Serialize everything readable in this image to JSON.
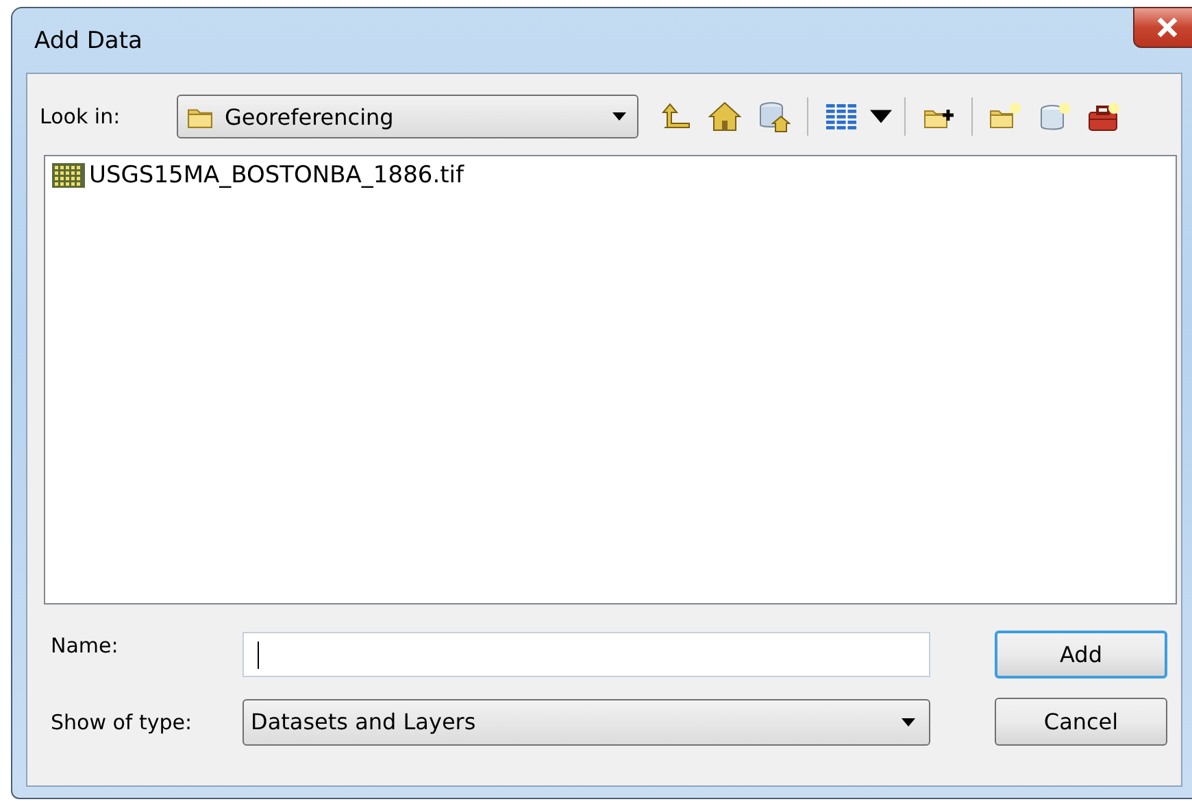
{
  "window": {
    "title": "Add Data"
  },
  "look_in": {
    "label": "Look in:",
    "value": "Georeferencing"
  },
  "files": [
    {
      "name": "USGS15MA_BOSTONBA_1886.tif",
      "kind": "raster"
    }
  ],
  "name_field": {
    "label": "Name:"
  },
  "type_field": {
    "label": "Show of type:",
    "value": "Datasets and Layers"
  },
  "buttons": [
    {
      "label": "Add",
      "kind": "default"
    },
    {
      "label": "Cancel",
      "kind": "normal"
    }
  ]
}
